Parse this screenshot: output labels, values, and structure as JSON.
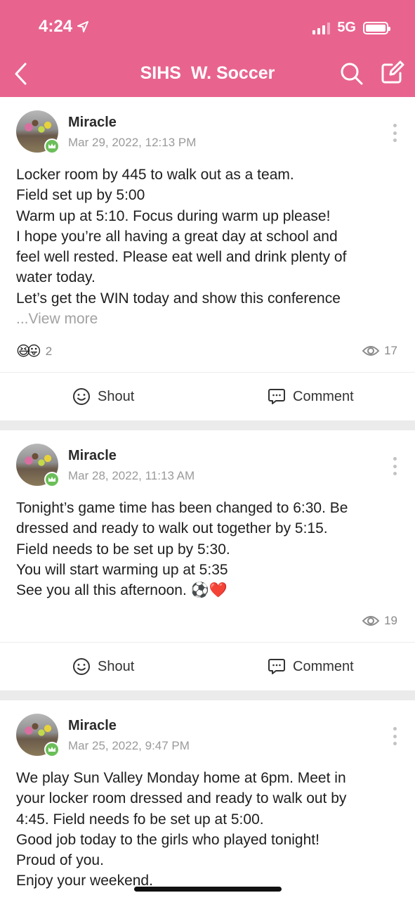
{
  "status_bar": {
    "time": "4:24",
    "network": "5G"
  },
  "nav": {
    "title": "SIHS  W. Soccer"
  },
  "posts": [
    {
      "author": "Miracle",
      "date": "Mar 29, 2022, 12:13 PM",
      "lines": [
        "Locker room by 445 to walk out as a team.",
        "Field set up by 5:00",
        "Warm up at 5:10. Focus during warm up please!",
        "I hope you’re all having a great day at school and",
        "feel well rested. Please eat well and drink plenty of",
        "water today.",
        "Let’s get the WIN today and show this conference"
      ],
      "view_more": "...View more",
      "reaction_emojis": "😆😛",
      "reaction_count": "2",
      "views": "17",
      "shout_label": "Shout",
      "comment_label": "Comment"
    },
    {
      "author": "Miracle",
      "date": "Mar 28, 2022, 11:13 AM",
      "lines": [
        "Tonight’s game time has been changed to 6:30. Be",
        "dressed and ready to walk out together by 5:15.",
        "Field needs to be set up by 5:30.",
        "You will start warming up at 5:35",
        "See you all this afternoon. ⚽❤️"
      ],
      "views": "19",
      "shout_label": "Shout",
      "comment_label": "Comment"
    },
    {
      "author": "Miracle",
      "date": "Mar 25, 2022, 9:47 PM",
      "lines": [
        "We play Sun Valley Monday home at 6pm. Meet in",
        "your locker room dressed and ready to walk out by",
        "4:45. Field needs fo be set up at 5:00.",
        "Good job today to the girls who played tonight!",
        "Proud of you.",
        "Enjoy your weekend."
      ]
    }
  ]
}
